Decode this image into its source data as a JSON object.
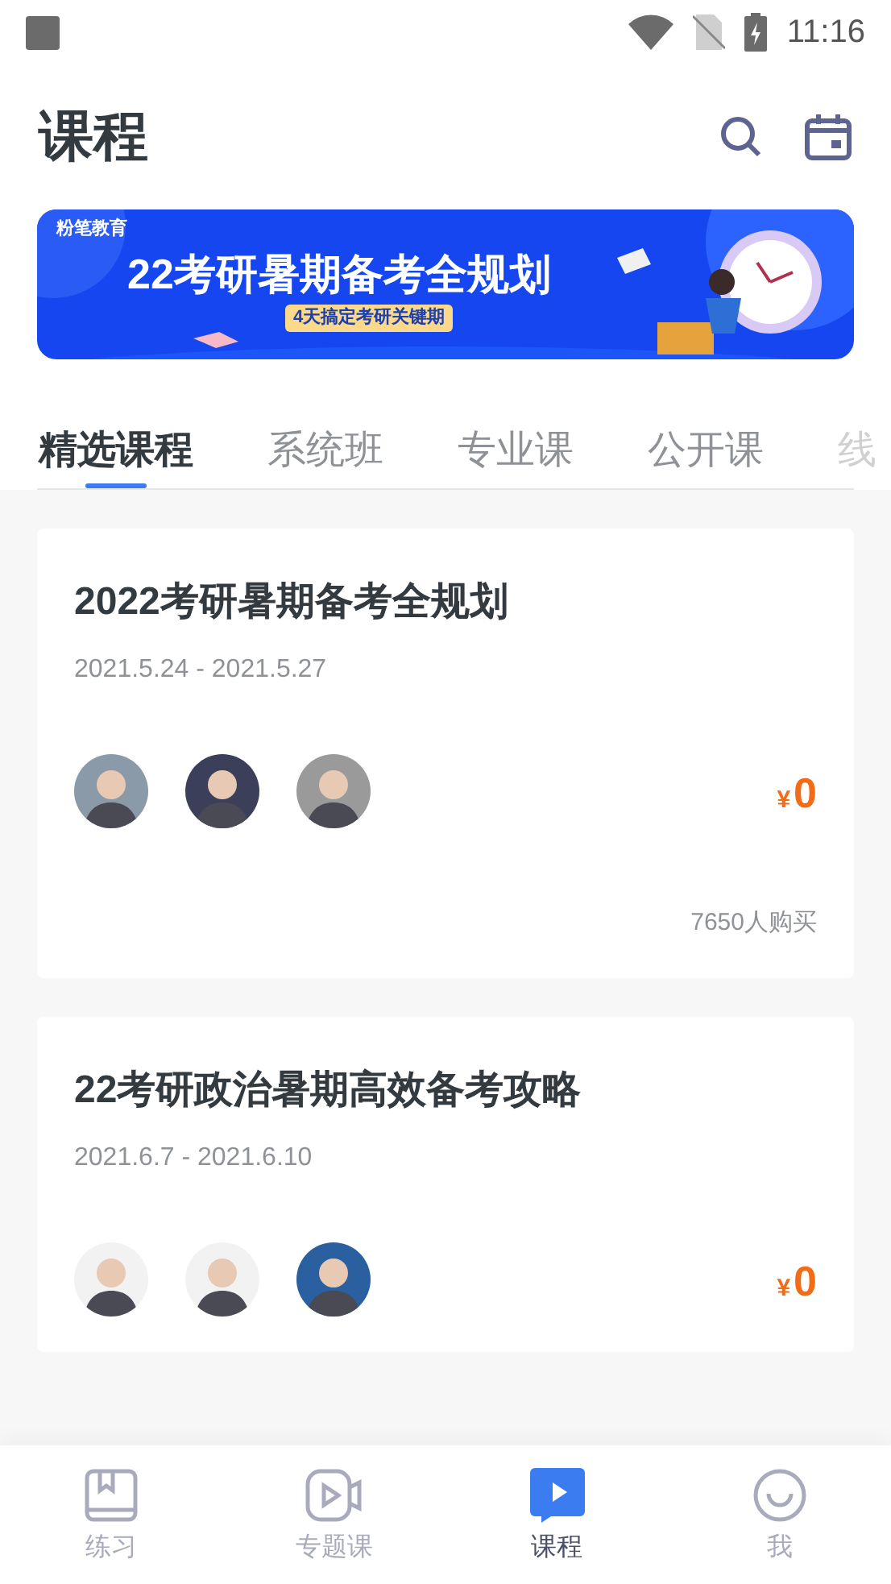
{
  "status_bar": {
    "time": "11:16"
  },
  "header": {
    "title": "课程"
  },
  "banner": {
    "brand": "粉笔教育",
    "headline": "22考研暑期备考全规划",
    "tagline": "4天搞定考研关键期"
  },
  "tabs": [
    {
      "label": "精选课程",
      "selected": true
    },
    {
      "label": "系统班",
      "selected": false
    },
    {
      "label": "专业课",
      "selected": false
    },
    {
      "label": "公开课",
      "selected": false
    },
    {
      "label": "线",
      "selected": false
    }
  ],
  "courses": [
    {
      "title": "2022考研暑期备考全规划",
      "dates": "2021.5.24 - 2021.5.27",
      "teachers": [
        {
          "color": "#8a9aa8"
        },
        {
          "color": "#3b3f5a"
        },
        {
          "color": "#9a9a9a"
        }
      ],
      "currency": "¥",
      "price": "0",
      "buyers": "7650人购买"
    },
    {
      "title": "22考研政治暑期高效备考攻略",
      "dates": "2021.6.7 - 2021.6.10",
      "teachers": [
        {
          "color": "#f2f2f2"
        },
        {
          "color": "#f2f2f2"
        },
        {
          "color": "#2a5fa0"
        }
      ],
      "currency": "¥",
      "price": "0"
    }
  ],
  "bottom_nav": [
    {
      "label": "练习",
      "kind": "book",
      "selected": false
    },
    {
      "label": "专题课",
      "kind": "video",
      "selected": false
    },
    {
      "label": "课程",
      "kind": "play",
      "selected": true
    },
    {
      "label": "我",
      "kind": "smile",
      "selected": false
    }
  ]
}
